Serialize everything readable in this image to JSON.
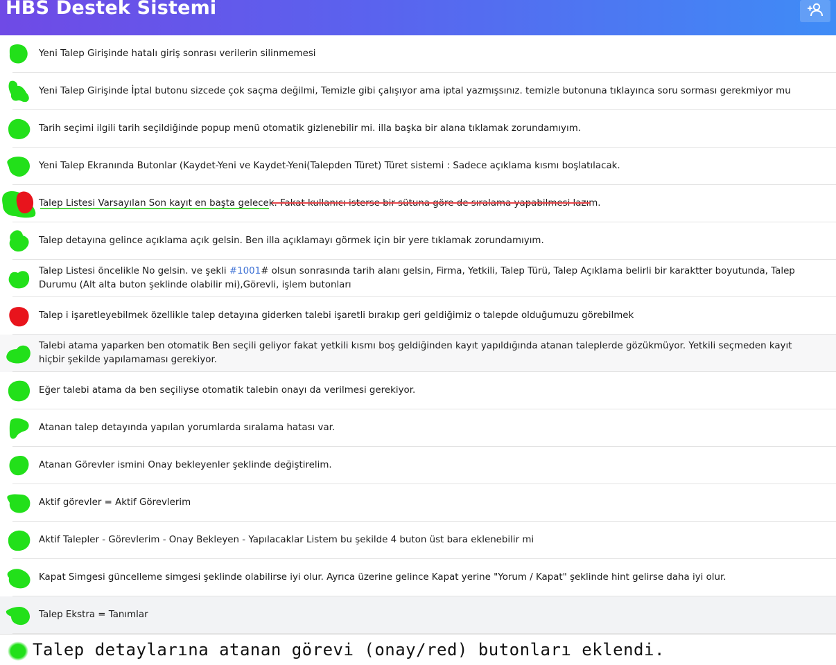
{
  "header": {
    "title": "HBS Destek Sistemi",
    "add_user_icon": "add-user-icon",
    "gradient_from": "#6f4ae6",
    "gradient_to": "#3f8cf6"
  },
  "status_colors": {
    "done": "#22e01a",
    "open": "#e8141c"
  },
  "items": [
    {
      "text": "Yeni Talep Girişinde hatalı giriş sonrası verilerin silinmemesi",
      "status": "done"
    },
    {
      "text": "Yeni Talep Girişinde İptal butonu sizcede çok saçma değilmi, Temizle gibi çalışıyor ama iptal yazmışsınız. temizle butonuna tıklayınca soru sorması gerekmiyor mu",
      "status": "done"
    },
    {
      "text": "Tarih seçimi ilgili tarih seçildiğinde popup menü otomatik gizlenebilir mi. illa başka bir alana tıklamak zorundamıyım.",
      "status": "done"
    },
    {
      "text": "Yeni Talep Ekranında Butonlar (Kaydet-Yeni ve Kaydet-Yeni(Talepden Türet) Türet sistemi : Sadece açıklama kısmı boşlatılacak.",
      "status": "done"
    },
    {
      "text_part1": "Talep Listesi Varsayılan Son kayıt en başta gelecek.",
      "text_part2": "Fakat kullanıcı isterse bir sütuna göre de sıralama yapabilmesi lazım.",
      "status": "partial"
    },
    {
      "text": "Talep detayına gelince açıklama açık gelsin. Ben illa açıklamayı görmek için bir yere tıklamak zorundamıyım.",
      "status": "done"
    },
    {
      "text_before": "Talep Listesi öncelikle No gelsin. ve şekli ",
      "link": "#1001",
      "text_after": "# olsun sonrasında tarih alanı gelsin, Firma, Yetkili, Talep Türü, Talep Açıklama belirli bir karaktter boyutunda,  Talep Durumu (Alt alta buton şeklinde olabilir mi),Görevli, işlem butonları",
      "status": "done"
    },
    {
      "text": "Talep i işaretleyebilmek özellikle talep detayına giderken talebi işaretli bırakıp geri geldiğimiz o talepde olduğumuzu görebilmek",
      "status": "open"
    },
    {
      "text": "Talebi atama yaparken ben otomatik Ben seçili geliyor fakat yetkili kısmı boş geldiğinden kayıt yapıldığında atanan taleplerde gözükmüyor. Yetkili seçmeden kayıt hiçbir şekilde yapılamaması gerekiyor.",
      "status": "done"
    },
    {
      "text": "Eğer talebi atama da ben seçiliyse otomatik talebin onayı da verilmesi gerekiyor.",
      "status": "done"
    },
    {
      "text": "Atanan talep detayında yapılan yorumlarda sıralama hatası var.",
      "status": "done"
    },
    {
      "text": "Atanan Görevler ismini Onay bekleyenler şeklinde değiştirelim.",
      "status": "done"
    },
    {
      "text": "Aktif görevler = Aktif Görevlerim",
      "status": "done"
    },
    {
      "text": "Aktif Talepler - Görevlerim - Onay Bekleyen - Yapılacaklar Listem bu şekilde 4 buton üst bara eklenebilir mi",
      "status": "done"
    },
    {
      "text": "Kapat Simgesi güncelleme simgesi şeklinde olabilirse iyi olur. Ayrıca üzerine gelince Kapat yerine \"Yorum / Kapat\"  şeklinde hint gelirse daha iyi olur.",
      "status": "done"
    },
    {
      "text": "Talep Ekstra = Tanımlar",
      "status": "done"
    }
  ],
  "footer": {
    "text": "Talep detaylarına atanan görevi (onay/red) butonları eklendi."
  }
}
